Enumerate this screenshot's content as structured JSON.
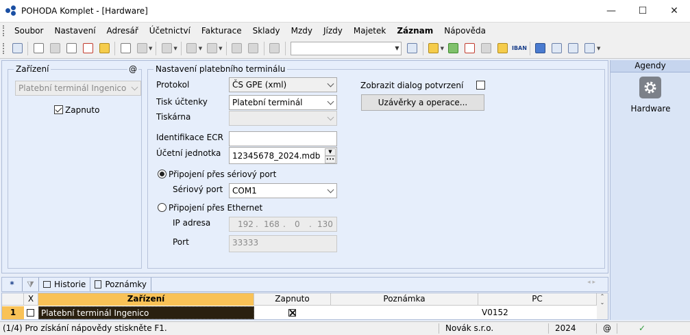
{
  "window": {
    "title": "POHODA Komplet - [Hardware]",
    "minimize": "—",
    "maximize": "☐",
    "close": "✕"
  },
  "menu": [
    "Soubor",
    "Nastavení",
    "Adresář",
    "Účetnictví",
    "Fakturace",
    "Sklady",
    "Mzdy",
    "Jízdy",
    "Majetek",
    "Záznam",
    "Nápověda"
  ],
  "toolbar": {
    "combo_value": "",
    "iban_label": "IBAN"
  },
  "device_group": {
    "title": "Zařízení",
    "at_symbol": "@",
    "device_select": "Platební terminál Ingenico",
    "enabled_label": "Zapnuto",
    "enabled_checked": true
  },
  "terminal_settings": {
    "title": "Nastavení platebního terminálu",
    "protocol_label": "Protokol",
    "protocol_value": "ČS GPE (xml)",
    "receipt_print_label": "Tisk účtenky",
    "receipt_print_value": "Platební terminál",
    "printer_label": "Tiskárna",
    "printer_value": "",
    "ecr_id_label": "Identifikace ECR",
    "ecr_id_value": "",
    "accounting_unit_label": "Účetní jednotka",
    "accounting_unit_value": "12345678_2024.mdb",
    "serial_radio_label": "Připojení přes sériový port",
    "serial_port_label": "Sériový port",
    "serial_port_value": "COM1",
    "ethernet_radio_label": "Připojení přes Ethernet",
    "ip_label": "IP adresa",
    "ip_octets": [
      "192",
      "168",
      "0",
      "130"
    ],
    "port_label": "Port",
    "port_value": "33333",
    "show_confirm_label": "Zobrazit dialog potvrzení",
    "show_confirm_checked": false,
    "closures_button": "Uzávěrky a operace..."
  },
  "agenda": {
    "header": "Agendy",
    "item_label": "Hardware"
  },
  "bottom_tabs": {
    "star": "*",
    "history": "Historie",
    "notes": "Poznámky"
  },
  "grid": {
    "columns": [
      "X",
      "Zařízení",
      "Zapnuto",
      "Poznámka",
      "PC"
    ],
    "rows": [
      {
        "num": "1",
        "device": "Platební terminál Ingenico",
        "enabled": true,
        "note": "",
        "pc": "V0152"
      }
    ]
  },
  "status": {
    "record_hint": "(1/4) Pro získání nápovědy stiskněte F1.",
    "company": "Novák s.r.o.",
    "year": "2024",
    "at": "@"
  }
}
